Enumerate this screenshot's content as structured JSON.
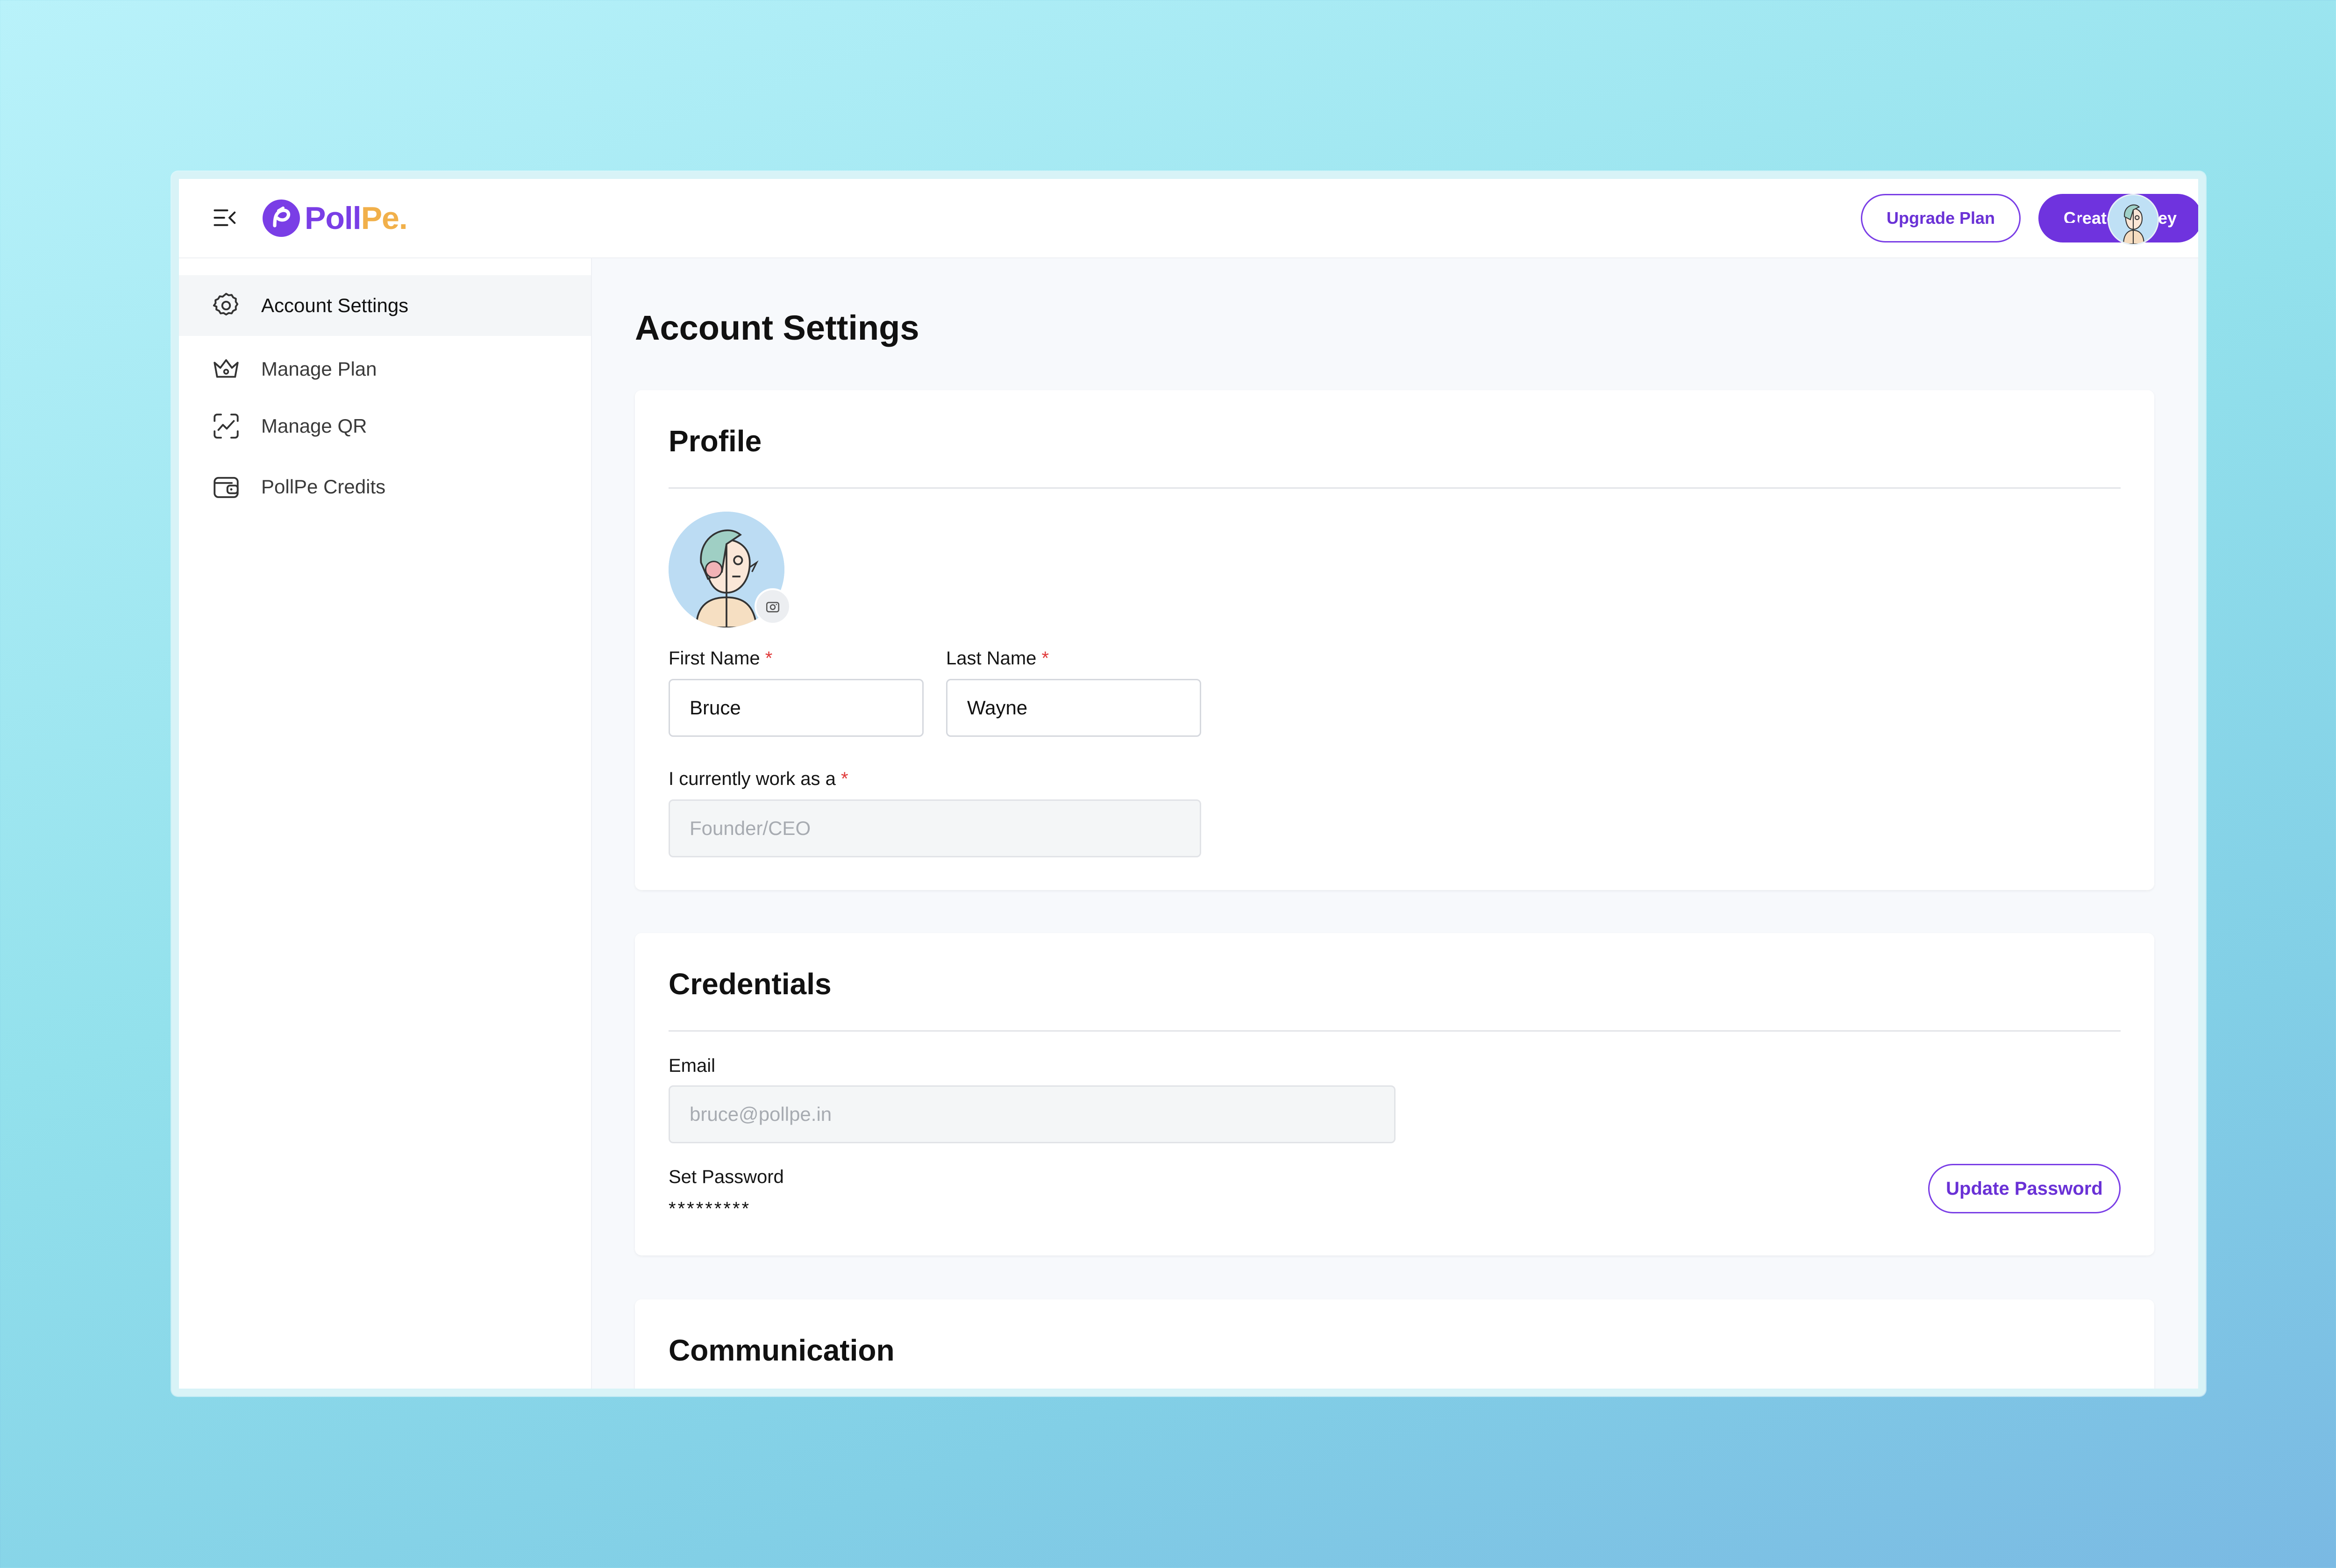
{
  "app": {
    "logo_poll": "Poll",
    "logo_pe": "Pe."
  },
  "header": {
    "upgrade_label": "Upgrade Plan",
    "create_label": "Create Survey"
  },
  "sidebar": {
    "items": [
      {
        "label": "Account Settings",
        "icon": "gear-icon",
        "active": true
      },
      {
        "label": "Manage Plan",
        "icon": "crown-icon",
        "active": false
      },
      {
        "label": "Manage QR",
        "icon": "qr-scan-icon",
        "active": false
      },
      {
        "label": "PollPe Credits",
        "icon": "wallet-icon",
        "active": false
      }
    ]
  },
  "page": {
    "title": "Account Settings"
  },
  "profile": {
    "title": "Profile",
    "first_name_label": "First Name",
    "first_name_value": "Bruce",
    "last_name_label": "Last Name",
    "last_name_value": "Wayne",
    "work_label": "I currently work as a",
    "work_placeholder": "Founder/CEO",
    "required_mark": "*"
  },
  "credentials": {
    "title": "Credentials",
    "email_label": "Email",
    "email_placeholder": "bruce@pollpe.in",
    "password_label": "Set Password",
    "password_mask": "*********",
    "update_label": "Update Password"
  },
  "communication": {
    "title": "Communication"
  },
  "colors": {
    "accent": "#6f33de",
    "logo_secondary": "#f1b04a",
    "required": "#e03a3a"
  }
}
